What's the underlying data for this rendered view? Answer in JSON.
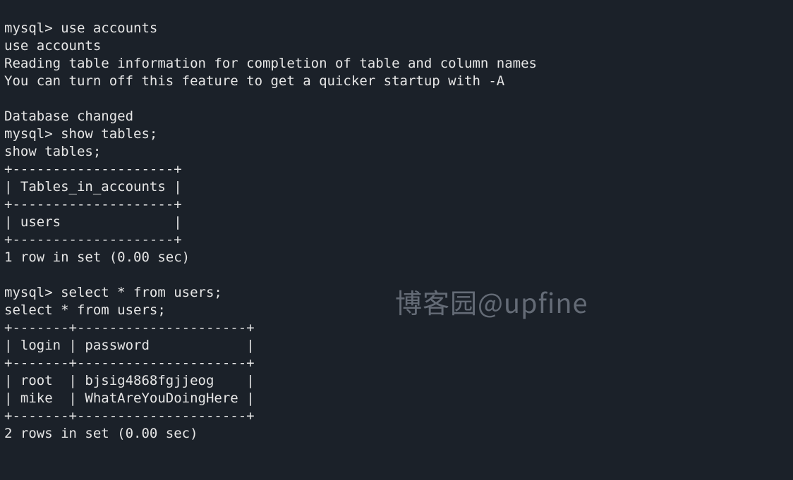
{
  "prompt": "mysql>",
  "commands": {
    "use_db": "use accounts",
    "use_db_echo": "use accounts",
    "reading_msg": "Reading table information for completion of table and column names",
    "turnoff_msg": "You can turn off this feature to get a quicker startup with -A",
    "db_changed": "Database changed",
    "show_tables": "show tables;",
    "show_tables_echo": "show tables;",
    "select_users": "select * from users;",
    "select_users_echo": "select * from users;"
  },
  "tables_table": {
    "border_top": "+--------------------+",
    "header_row": "| Tables_in_accounts |",
    "border_mid": "+--------------------+",
    "data_row": "| users              |",
    "border_bot": "+--------------------+"
  },
  "tables_footer": "1 row in set (0.00 sec)",
  "users_table": {
    "border_top": "+-------+---------------------+",
    "header_row": "| login | password            |",
    "border_mid": "+-------+---------------------+",
    "row1": "| root  | bjsig4868fgjjeog    |",
    "row2": "| mike  | WhatAreYouDoingHere |",
    "border_bot": "+-------+---------------------+"
  },
  "users_footer": "2 rows in set (0.00 sec)",
  "watermark": "博客园@upfine",
  "chart_data": {
    "type": "table",
    "title": "users",
    "columns": [
      "login",
      "password"
    ],
    "rows": [
      [
        "root",
        "bjsig4868fgjjeog"
      ],
      [
        "mike",
        "WhatAreYouDoingHere"
      ]
    ]
  }
}
